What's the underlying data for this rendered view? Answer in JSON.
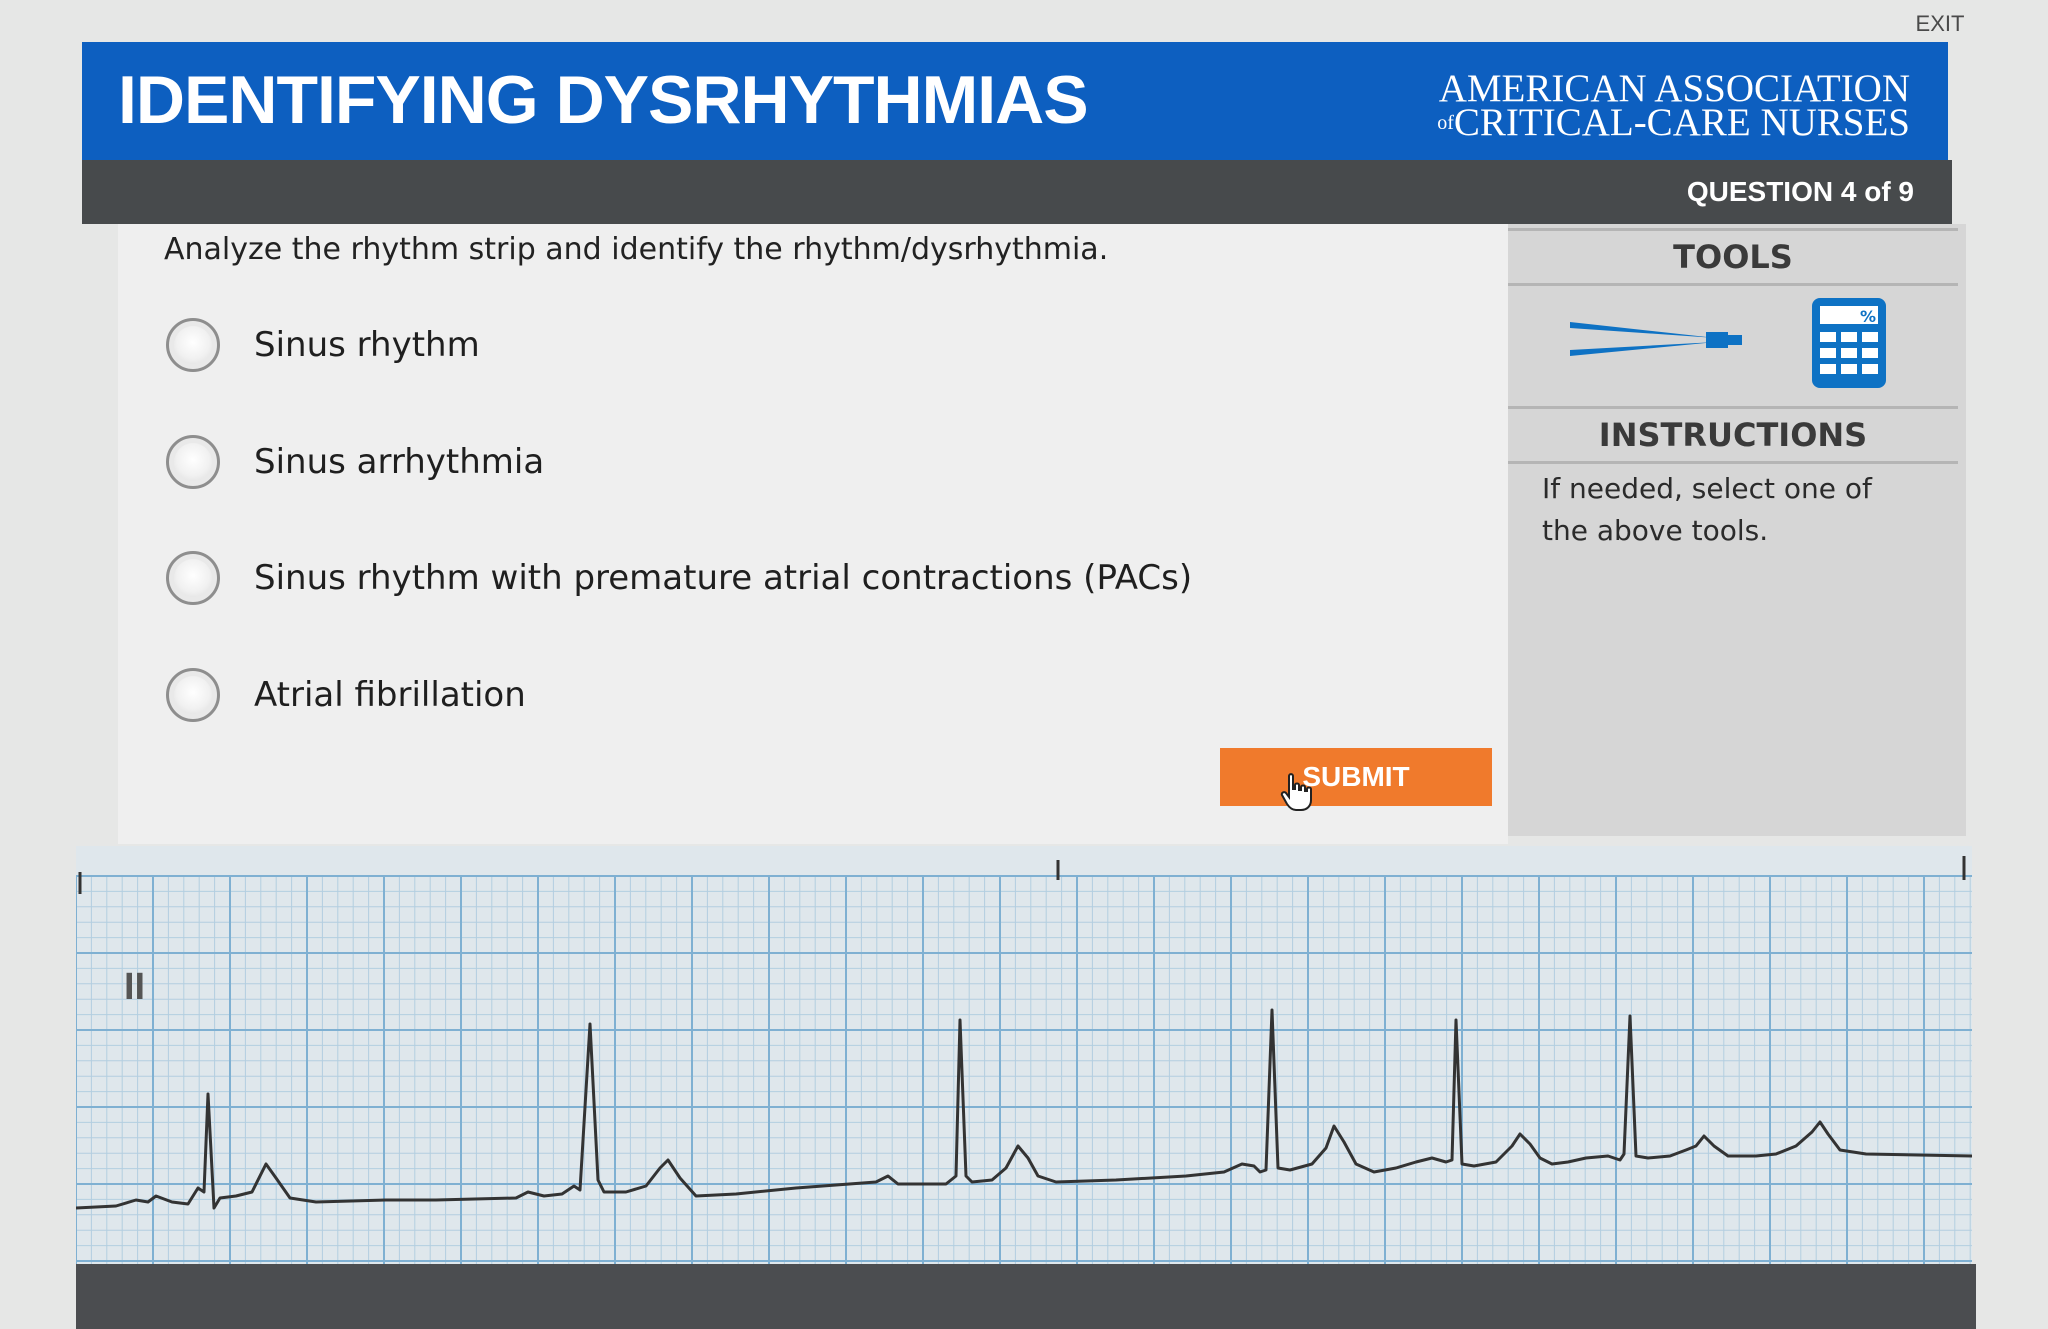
{
  "exit_label": "EXIT",
  "header": {
    "title": "IDENTIFYING DYSRHYTHMIAS",
    "org_line1": "AMERICAN ASSOCIATION",
    "org_of": "of",
    "org_line2": "CRITICAL-CARE NURSES"
  },
  "question_counter": "QUESTION 4 of 9",
  "prompt": "Analyze the rhythm strip and identify the rhythm/dysrhythmia.",
  "options": [
    {
      "label": "Sinus rhythm"
    },
    {
      "label": "Sinus arrhythmia"
    },
    {
      "label": "Sinus rhythm with premature atrial contractions (PACs)"
    },
    {
      "label": "Atrial fibrillation"
    }
  ],
  "submit_label": "SUBMIT",
  "sidebar": {
    "tools_heading": "TOOLS",
    "instructions_heading": "INSTRUCTIONS",
    "instructions_text": "If needed, select one of the above tools.",
    "tools": [
      {
        "icon": "caliper-icon"
      },
      {
        "icon": "calculator-icon",
        "badge": "%"
      }
    ]
  },
  "rhythm_strip": {
    "lead_label": "II"
  },
  "colors": {
    "header_blue": "#0d5fc0",
    "submit_orange": "#f07a2c",
    "dark_bar": "#474a4c",
    "tool_blue": "#0e72c4",
    "grid_line": "#9fc3dc",
    "ecg_trace": "#333333"
  }
}
